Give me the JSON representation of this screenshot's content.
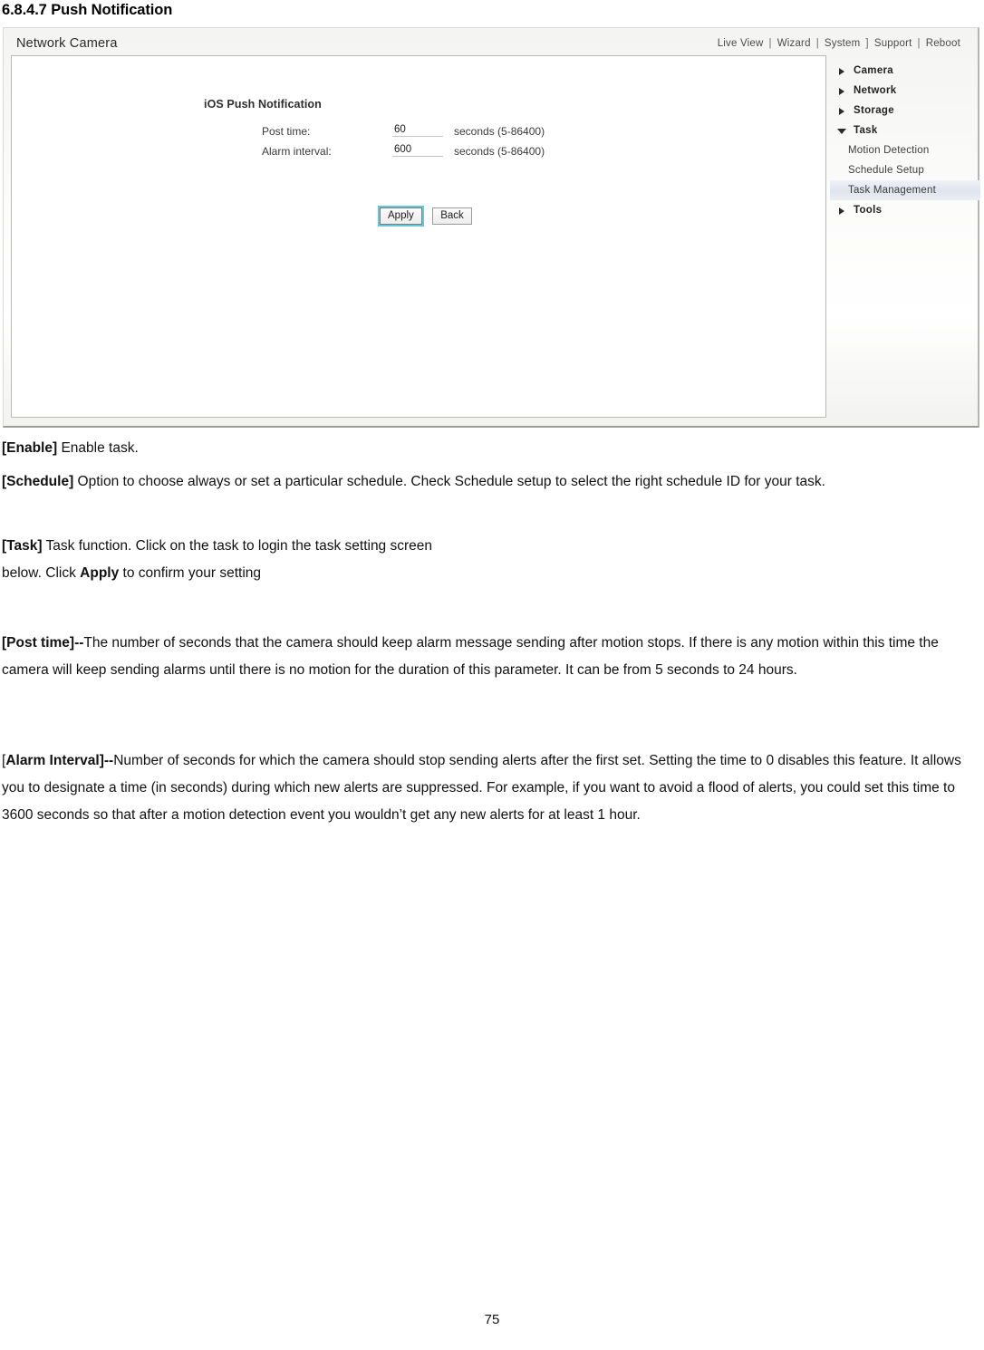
{
  "document": {
    "heading": "6.8.4.7 Push Notification",
    "page_number": "75"
  },
  "figure": {
    "window_title": "Network Camera",
    "topnav": {
      "items": [
        "Live View",
        "Wizard",
        "System",
        "Support",
        "Reboot"
      ],
      "separator": "|",
      "separator_alt": "]"
    },
    "form": {
      "title": "iOS Push Notification",
      "fields": [
        {
          "label": "Post time:",
          "value": "60",
          "placeholder": "",
          "hint": "seconds (5-86400)"
        },
        {
          "label": "Alarm interval:",
          "value": "600",
          "placeholder": "",
          "hint": "seconds (5-86400)"
        }
      ],
      "buttons": {
        "apply": "Apply",
        "back": "Back"
      }
    },
    "tree": [
      {
        "label": "Camera",
        "type": "parent",
        "icon": "triangle-right-icon",
        "expanded": false,
        "selected": false
      },
      {
        "label": "Network",
        "type": "parent",
        "icon": "triangle-right-icon",
        "expanded": false,
        "selected": false
      },
      {
        "label": "Storage",
        "type": "parent",
        "icon": "triangle-right-icon",
        "expanded": false,
        "selected": false
      },
      {
        "label": "Task",
        "type": "parent",
        "icon": "triangle-down-icon",
        "expanded": true,
        "selected": false
      },
      {
        "label": "Motion Detection",
        "type": "child",
        "icon": "",
        "expanded": false,
        "selected": false
      },
      {
        "label": "Schedule Setup",
        "type": "child",
        "icon": "",
        "expanded": false,
        "selected": false
      },
      {
        "label": "Task Management",
        "type": "child",
        "icon": "",
        "expanded": false,
        "selected": true
      },
      {
        "label": "Tools",
        "type": "parent",
        "icon": "triangle-right-icon",
        "expanded": false,
        "selected": false
      }
    ]
  },
  "body": {
    "enable_term": "[Enable]",
    "enable_text": " Enable task.",
    "schedule_term": "[Schedule]",
    "schedule_text": " Option to choose always or set a particular schedule. Check Schedule setup to select the right schedule ID for your task.",
    "task_term": "[Task]",
    "task_text_a": " Task function. Click on the task to login the task setting screen",
    "task_text_b": "below. Click ",
    "task_apply_word": "Apply",
    "task_text_c": " to confirm your setting",
    "posttime_term": "[Post time]--",
    "posttime_text": "The number of seconds that the camera should keep alarm message sending after motion stops. If there is any motion within this time the camera will keep sending alarms until there is no motion for the duration of this parameter. It can be from 5 seconds to 24 hours.",
    "alarm_bracket_open": "[",
    "alarm_term": "Alarm Interval]--",
    "alarm_text": "Number of seconds for which the camera should stop sending alerts after the first set. Setting the time to 0 disables this feature. It allows you to designate a time (in seconds) during which new alerts are suppressed. For example, if you want to avoid a flood of alerts, you could set this time to 3600 seconds so that after a motion detection event you wouldn’t get any new alerts for at least 1 hour."
  },
  "colors": {
    "focus_outline": "#63c8de",
    "selection_bg": "#dfe3ec",
    "panel_border": "#b9b9b6"
  }
}
